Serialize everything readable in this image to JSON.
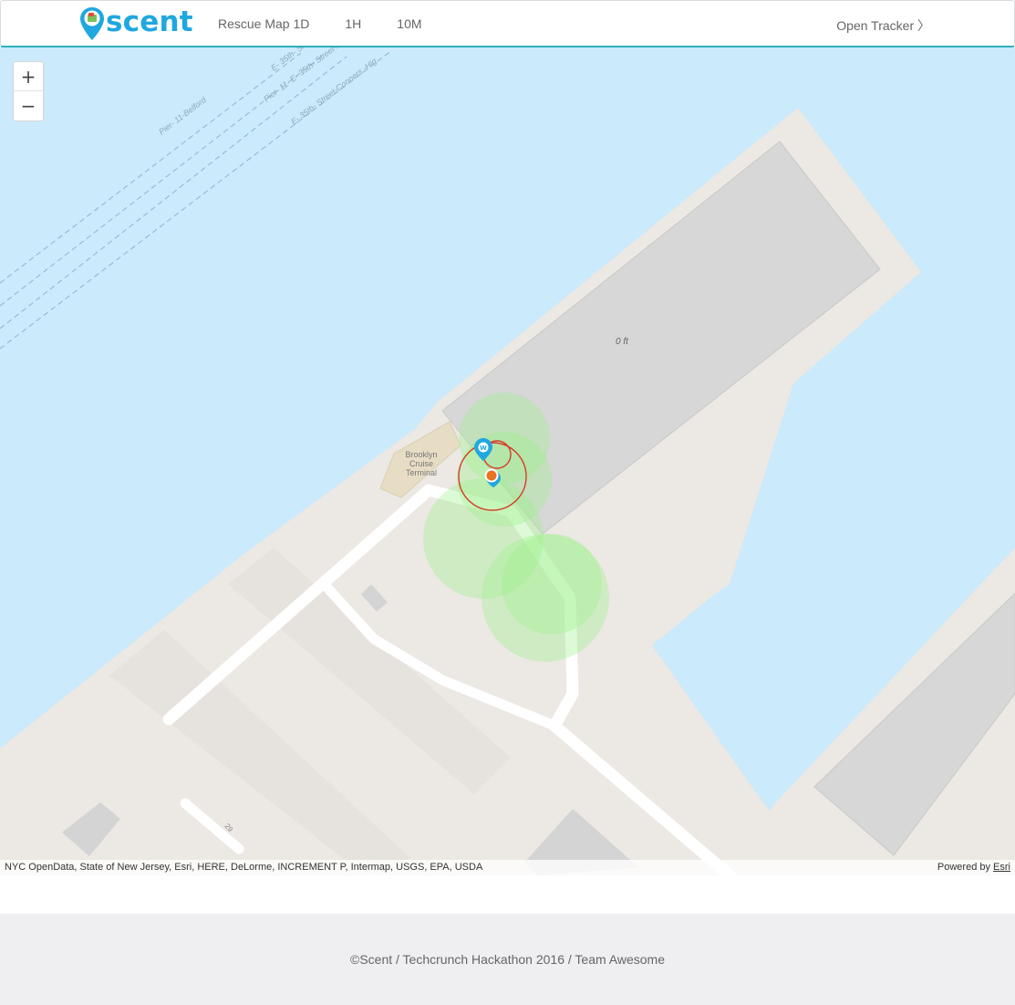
{
  "brand": {
    "name": "scent"
  },
  "nav": {
    "links": [
      {
        "label": "Rescue Map 1D"
      },
      {
        "label": "1H"
      },
      {
        "label": "10M"
      }
    ],
    "right_link": "Open Tracker 〉"
  },
  "map": {
    "zoom_in": "+",
    "zoom_out": "−",
    "labels": {
      "pier_belford": "Pier- 11-Belford",
      "pier_atlantic": "Pier- 11- E- 35th- Street-Atlantic",
      "pier_conners": "E- 35th- Street- Pier- 11-Conners",
      "pier_conners_hwy": "E- 35th- Street-Conners -Hig",
      "elevation": "0 ft",
      "terminal_line1": "Brooklyn",
      "terminal_line2": "Cruise",
      "terminal_line3": "Terminal",
      "street_number": "29",
      "marker_letter": "W"
    },
    "colors": {
      "water": "#cbeafb",
      "land": "#ece8e3",
      "building": "#d7d7d7",
      "heat": "#a9f59a",
      "track": "#d93a26",
      "position_dot": "#e87423",
      "marker": "#1fa7e0"
    }
  },
  "attribution": {
    "sources": "NYC OpenData, State of New Jersey, Esri, HERE, DeLorme, INCREMENT P, Intermap, USGS, EPA, USDA",
    "powered_by": "Powered by",
    "provider": "Esri"
  },
  "footer": {
    "text": "©Scent / Techcrunch Hackathon 2016 / Team Awesome"
  }
}
